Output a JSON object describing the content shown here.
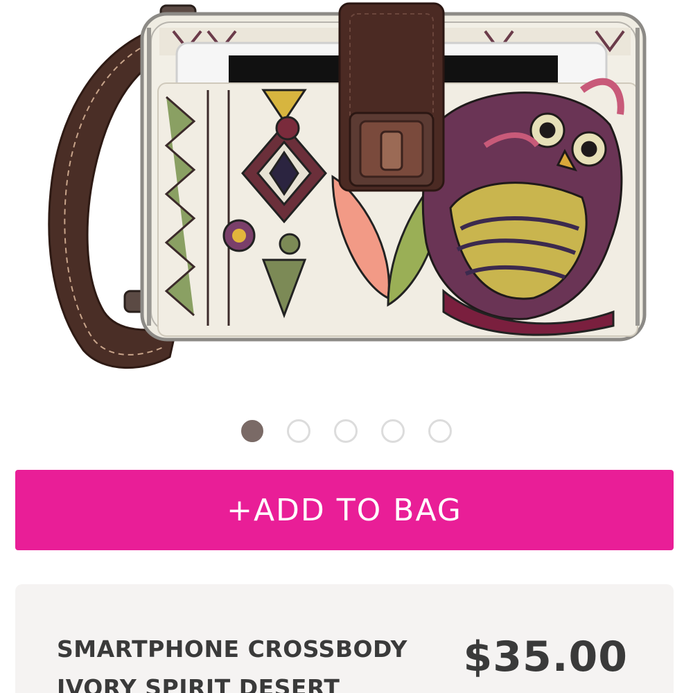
{
  "product": {
    "image_alt": "Smartphone crossbody wallet with ivory spirit desert owl print, brown leather wrist strap and turnlock flap",
    "name_line1": "SMARTPHONE CROSSBODY",
    "name_line2": "IVORY SPIRIT DESERT",
    "price": "$35.00"
  },
  "carousel": {
    "total": 5,
    "active_index": 0
  },
  "actions": {
    "add_to_bag_label": "+ADD TO BAG"
  },
  "colors": {
    "accent": "#e91e97",
    "active_dot": "#7a6a66",
    "inactive_dot_border": "#dcdcdc",
    "card_background": "#f5f3f2",
    "text_dark": "#3a3a3a"
  }
}
